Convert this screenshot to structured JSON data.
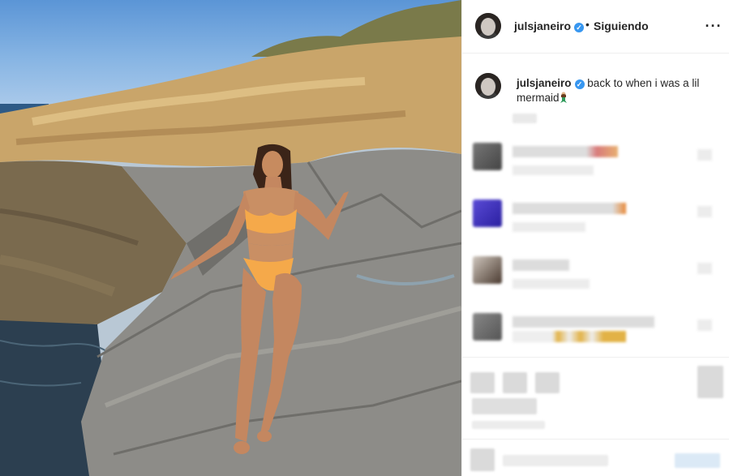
{
  "post": {
    "username": "julsjaneiro",
    "verified_mark": "✓",
    "separator": "•",
    "follow_status": "Siguiendo",
    "more_label": "···"
  },
  "caption": {
    "username": "julsjaneiro",
    "verified_mark": "✓",
    "text_line1": "back to when i was a lil",
    "text_line2": "mermaid",
    "emoji_icon": "mermaid-emoji-icon"
  },
  "icons": {
    "verified": "verified-badge-icon",
    "more": "more-options-icon"
  },
  "colors": {
    "verified": "#3897f0",
    "bikini": "#f5a94a",
    "sky": "#7fb0e2",
    "rock": "#8b8a86"
  }
}
